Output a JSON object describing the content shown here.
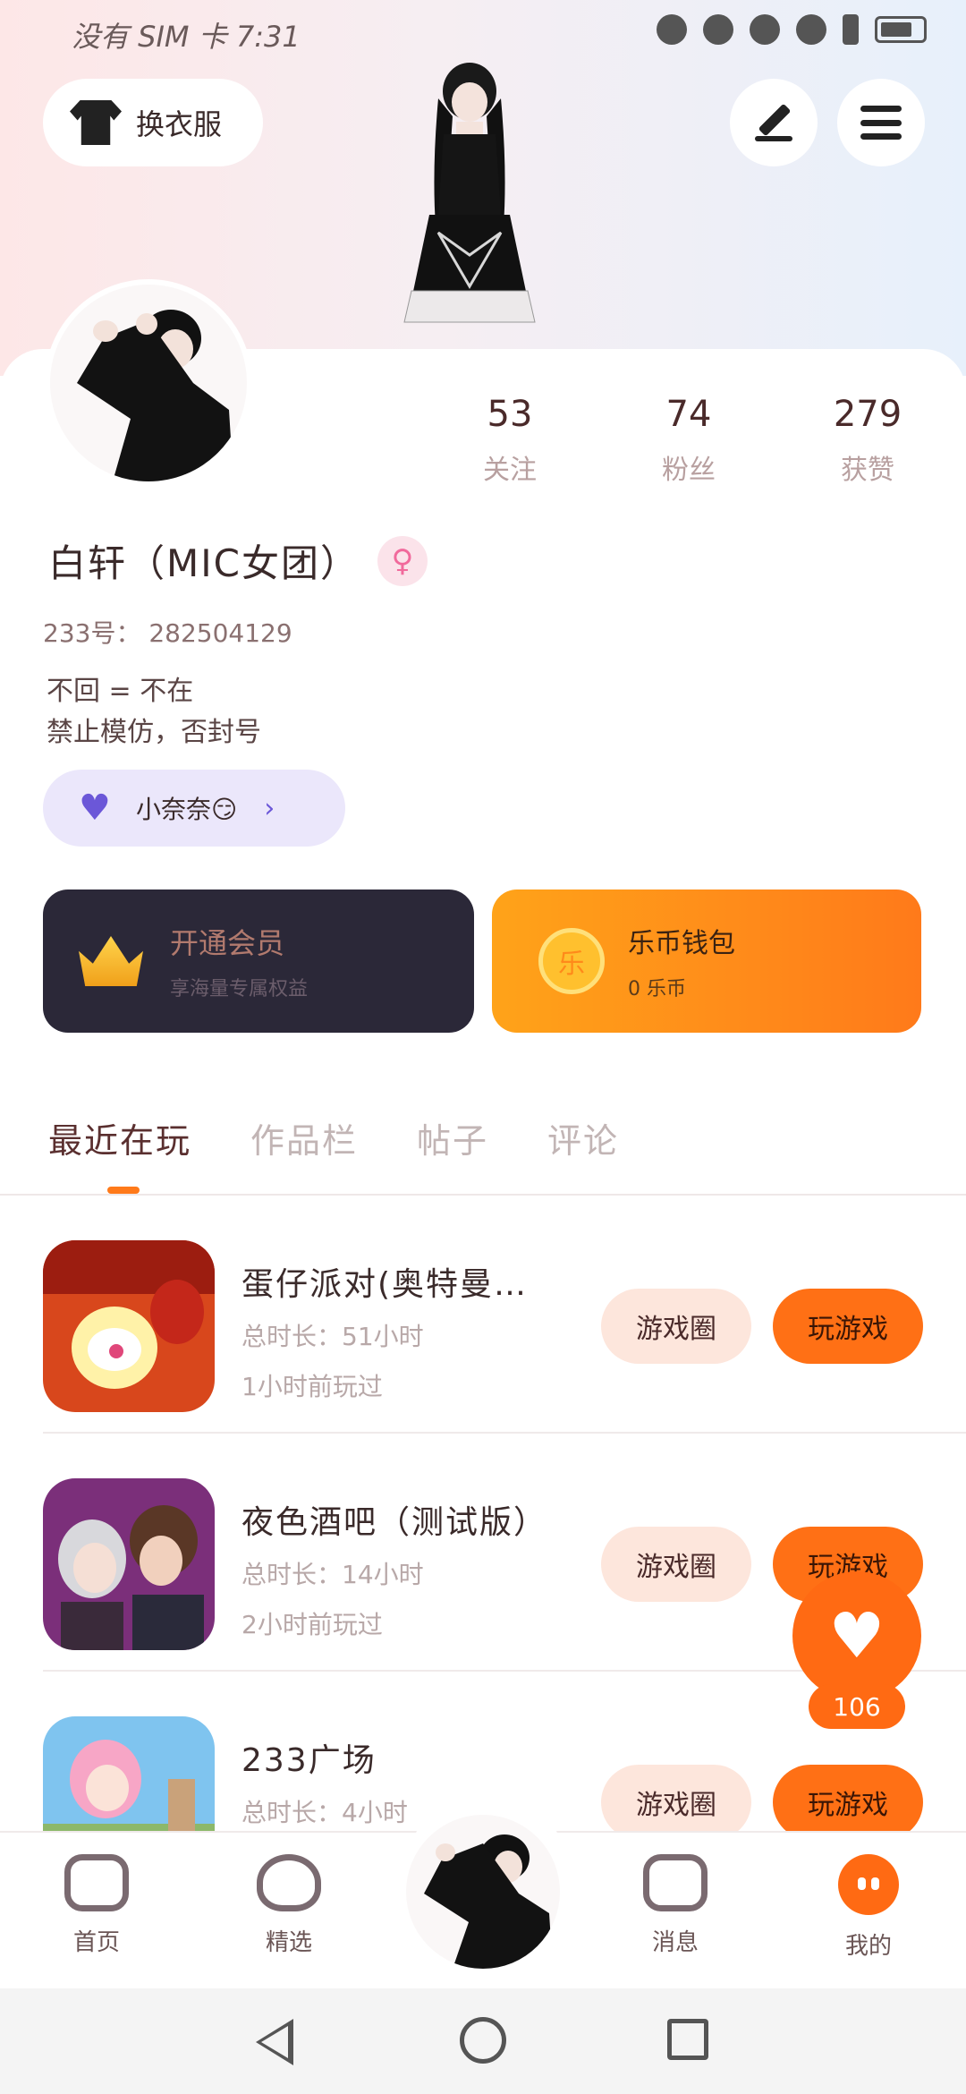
{
  "status_bar": {
    "carrier_time": "没有 SIM 卡 7:31"
  },
  "header": {
    "outfit_button": "换衣服"
  },
  "profile": {
    "stats": [
      {
        "value": "53",
        "label": "关注"
      },
      {
        "value": "74",
        "label": "粉丝"
      },
      {
        "value": "279",
        "label": "获赞"
      }
    ],
    "name": "白轩（MIC女团）",
    "gender_symbol": "♀",
    "uid": "233号： 282504129",
    "bio_line1": "不回 = 不在",
    "bio_line2": "禁止模仿，否封号",
    "tag": {
      "label": "小奈奈😏",
      "icon": "heart-icon"
    }
  },
  "cards": {
    "vip": {
      "title": "开通会员",
      "subtitle": "享海量专属权益"
    },
    "wallet": {
      "coin_label": "乐",
      "title": "乐币钱包",
      "subtitle": "0 乐币"
    }
  },
  "tabs": [
    "最近在玩",
    "作品栏",
    "帖子",
    "评论"
  ],
  "games": [
    {
      "name": "蛋仔派对(奥特曼…",
      "duration": "总时长：51小时",
      "last_played": "1小时前玩过",
      "circle_btn": "游戏圈",
      "play_btn": "玩游戏"
    },
    {
      "name": "夜色酒吧（测试版）",
      "duration": "总时长：14小时",
      "last_played": "2小时前玩过",
      "circle_btn": "游戏圈",
      "play_btn": "玩游戏"
    },
    {
      "name": "233广场",
      "duration": "总时长：4小时",
      "last_played": "",
      "circle_btn": "游戏圈",
      "play_btn": "玩游戏"
    }
  ],
  "fab": {
    "count": "106"
  },
  "bottom_nav": [
    {
      "label": "首页",
      "icon": "gamepad-icon"
    },
    {
      "label": "精选",
      "icon": "heart-icon"
    },
    {
      "label": "消息",
      "icon": "chat-icon"
    },
    {
      "label": "我的",
      "icon": "me-icon"
    }
  ],
  "colors": {
    "accent": "#ff6a13",
    "vip_bg": "#2b2838",
    "tag_bg": "#ebe7fb"
  }
}
